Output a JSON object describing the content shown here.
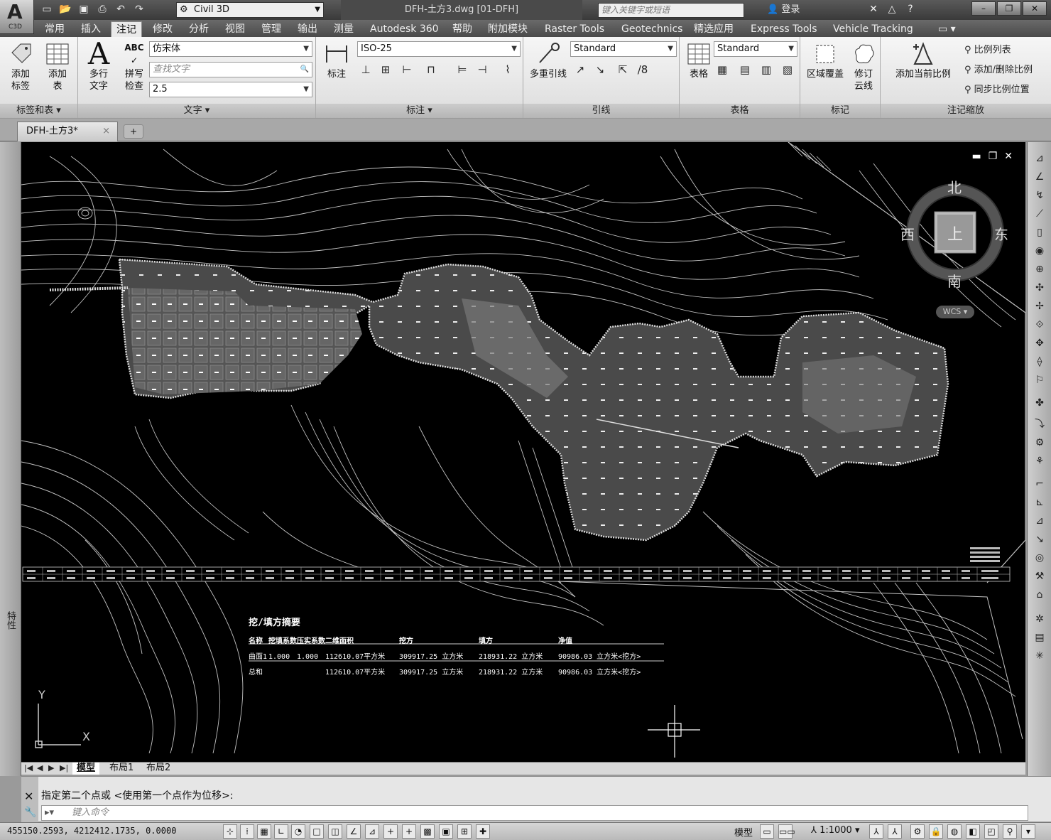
{
  "app": {
    "logo_text": "A",
    "logo_sub": "C3D",
    "workspace": "Civil 3D",
    "doc_title": "DFH-土方3.dwg [01-DFH]",
    "search_placeholder": "键入关键字或短语",
    "login": "登录",
    "help": "?"
  },
  "ribbon_tabs": [
    "常用",
    "插入",
    "注记",
    "修改",
    "分析",
    "视图",
    "管理",
    "输出",
    "测量",
    "Autodesk 360",
    "帮助",
    "附加模块",
    "Raster Tools",
    "Geotechnics",
    "精选应用",
    "Express Tools",
    "Vehicle Tracking"
  ],
  "ribbon": {
    "p1": {
      "title": "标签和表",
      "btn1": "添加\n标签",
      "btn2": "添加\n表"
    },
    "p2": {
      "title": "文字",
      "multi_text": "多行\n文字",
      "spell": "拼写\n检查",
      "abc": "ABC",
      "font": "仿宋体",
      "find": "查找文字",
      "height": "2.5"
    },
    "p3": {
      "title": "标注",
      "dim_btn": "标注",
      "style": "ISO-25"
    },
    "p4": {
      "title": "引线",
      "mleader": "多重引线",
      "style": "Standard"
    },
    "p5": {
      "title": "表格",
      "table_btn": "表格",
      "style": "Standard"
    },
    "p6": {
      "title": "标记",
      "wipeout": "区域覆盖",
      "revcloud": "修订\n云线"
    },
    "p7": {
      "title": "注记缩放",
      "add_scale": "添加当前比例",
      "scale_list": "比例列表",
      "add_del": "添加/删除比例",
      "sync": "同步比例位置"
    }
  },
  "file_tab": {
    "name": "DFH-土方3*",
    "close": "×"
  },
  "props_label": "特性",
  "viewcube": {
    "north": "北",
    "south": "南",
    "east": "东",
    "west": "西",
    "top": "上",
    "wcs": "WCS"
  },
  "axis": {
    "y": "Y",
    "x": "X"
  },
  "summary": {
    "title": "挖/填方摘要",
    "headers": [
      "名称",
      "挖填系数",
      "压实系数",
      "二维面积",
      "挖方",
      "填方",
      "净值"
    ],
    "rows": [
      [
        "曲面1",
        "1.000",
        "1.000",
        "112610.07平方米",
        "309917.25 立方米",
        "218931.22 立方米",
        "90986.03 立方米<挖方>"
      ],
      [
        "总和",
        "",
        "",
        "112610.07平方米",
        "309917.25 立方米",
        "218931.22 立方米",
        "90986.03 立方米<挖方>"
      ]
    ]
  },
  "layout_tabs": [
    "模型",
    "布局1",
    "布局2"
  ],
  "command": {
    "history": "指定第二个点或 <使用第一个点作为位移>:",
    "placeholder": "键入命令"
  },
  "status": {
    "coords": "455150.2593,  4212412.1735,  0.0000",
    "model": "模型",
    "scale": "1:1000"
  }
}
